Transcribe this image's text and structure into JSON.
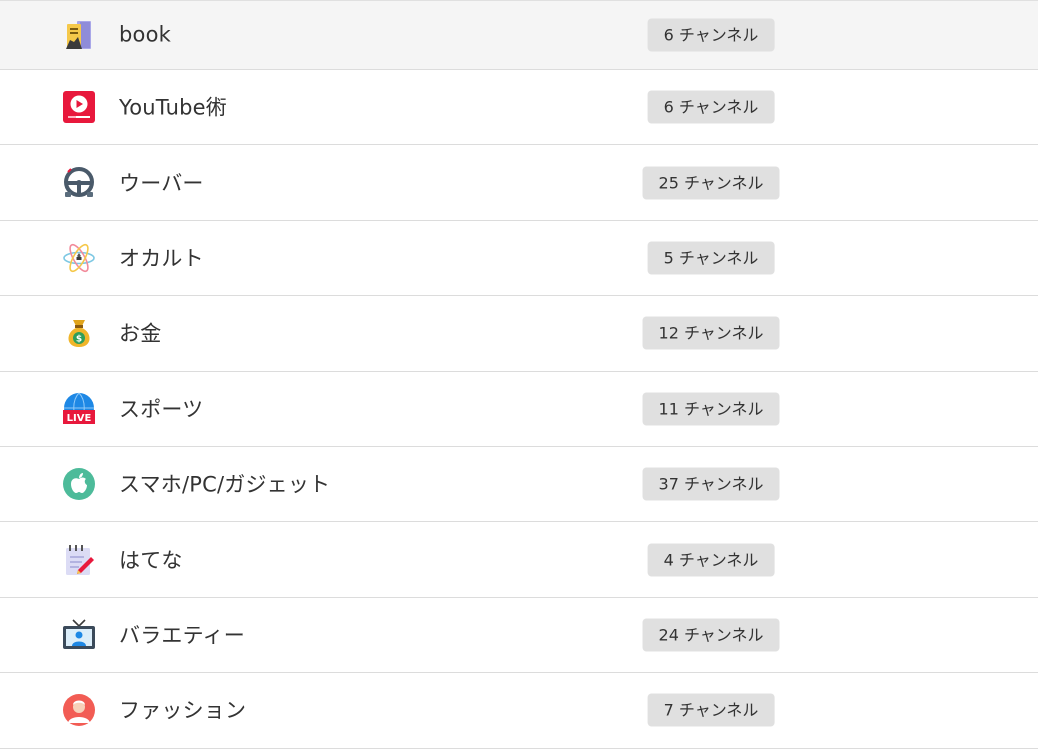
{
  "categories": [
    {
      "label": "book",
      "count": "6 チャンネル",
      "icon": "book-icon"
    },
    {
      "label": "YouTube術",
      "count": "6 チャンネル",
      "icon": "youtube-play-icon"
    },
    {
      "label": "ウーバー",
      "count": "25 チャンネル",
      "icon": "steering-wheel-icon"
    },
    {
      "label": "オカルト",
      "count": "5 チャンネル",
      "icon": "atom-icon"
    },
    {
      "label": "お金",
      "count": "12 チャンネル",
      "icon": "money-bag-icon"
    },
    {
      "label": "スポーツ",
      "count": "11 チャンネル",
      "icon": "live-globe-icon"
    },
    {
      "label": "スマホ/PC/ガジェット",
      "count": "37 チャンネル",
      "icon": "apple-icon"
    },
    {
      "label": "はてな",
      "count": "4 チャンネル",
      "icon": "notepad-pen-icon"
    },
    {
      "label": "バラエティー",
      "count": "24 チャンネル",
      "icon": "television-icon"
    },
    {
      "label": "ファッション",
      "count": "7 チャンネル",
      "icon": "person-avatar-icon"
    }
  ],
  "colors": {
    "badge_bg": "#e0e0e0",
    "row_hover_bg": "#f5f5f5",
    "divider": "#dcdcdc",
    "text": "#333333"
  }
}
